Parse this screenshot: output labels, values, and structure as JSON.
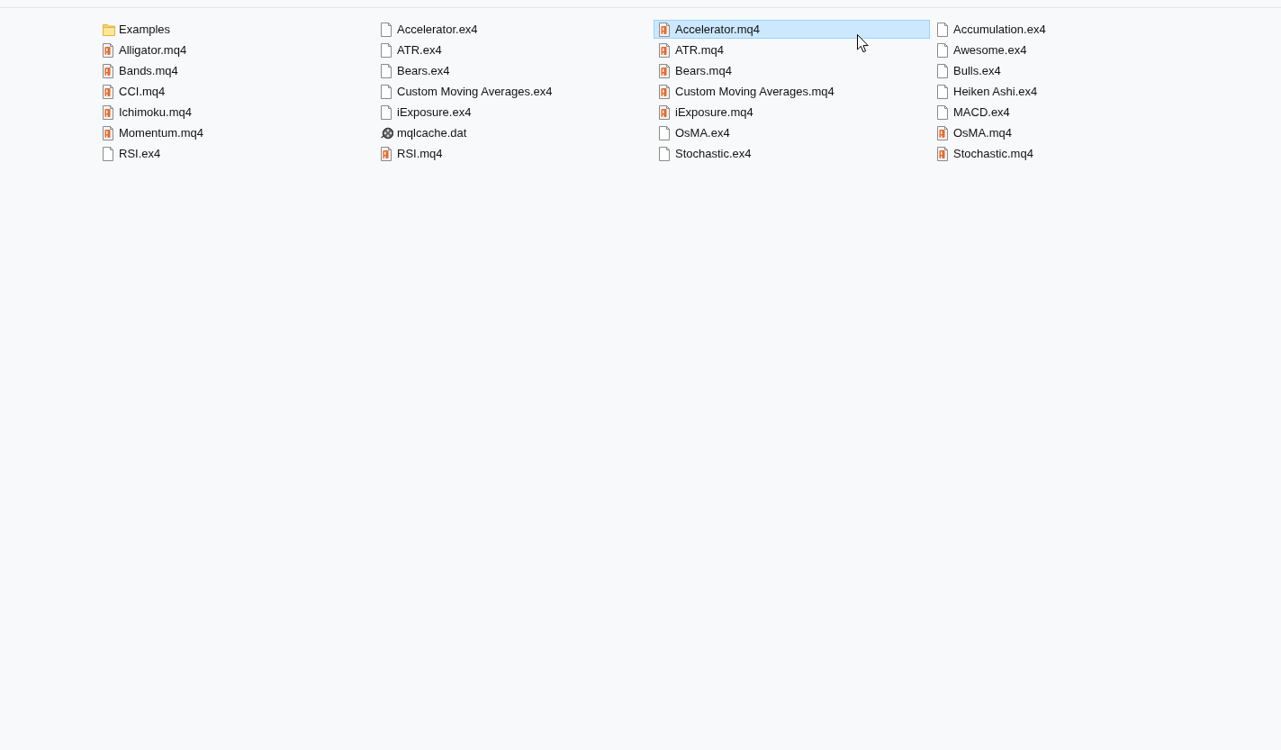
{
  "files": [
    {
      "name": "Examples",
      "kind": "folder",
      "selected": false
    },
    {
      "name": "Alligator.mq4",
      "kind": "source",
      "selected": false
    },
    {
      "name": "Bands.mq4",
      "kind": "source",
      "selected": false
    },
    {
      "name": "CCI.mq4",
      "kind": "source",
      "selected": false
    },
    {
      "name": "Ichimoku.mq4",
      "kind": "source",
      "selected": false
    },
    {
      "name": "Momentum.mq4",
      "kind": "source",
      "selected": false
    },
    {
      "name": "RSI.ex4",
      "kind": "binary",
      "selected": false
    },
    {
      "name": "Accelerator.ex4",
      "kind": "binary",
      "selected": false
    },
    {
      "name": "ATR.ex4",
      "kind": "binary",
      "selected": false
    },
    {
      "name": "Bears.ex4",
      "kind": "binary",
      "selected": false
    },
    {
      "name": "Custom Moving Averages.ex4",
      "kind": "binary",
      "selected": false
    },
    {
      "name": "iExposure.ex4",
      "kind": "binary",
      "selected": false
    },
    {
      "name": "mqlcache.dat",
      "kind": "data",
      "selected": false
    },
    {
      "name": "RSI.mq4",
      "kind": "source",
      "selected": false
    },
    {
      "name": "Accelerator.mq4",
      "kind": "source",
      "selected": true
    },
    {
      "name": "ATR.mq4",
      "kind": "source",
      "selected": false
    },
    {
      "name": "Bears.mq4",
      "kind": "source",
      "selected": false
    },
    {
      "name": "Custom Moving Averages.mq4",
      "kind": "source",
      "selected": false
    },
    {
      "name": "iExposure.mq4",
      "kind": "source",
      "selected": false
    },
    {
      "name": "OsMA.ex4",
      "kind": "binary",
      "selected": false
    },
    {
      "name": "Stochastic.ex4",
      "kind": "binary",
      "selected": false
    },
    {
      "name": "Accumulation.ex4",
      "kind": "binary",
      "selected": false
    },
    {
      "name": "Awesome.ex4",
      "kind": "binary",
      "selected": false
    },
    {
      "name": "Bulls.ex4",
      "kind": "binary",
      "selected": false
    },
    {
      "name": "Heiken Ashi.ex4",
      "kind": "binary",
      "selected": false
    },
    {
      "name": "MACD.ex4",
      "kind": "binary",
      "selected": false
    },
    {
      "name": "OsMA.mq4",
      "kind": "source",
      "selected": false
    },
    {
      "name": "Stochastic.mq4",
      "kind": "source",
      "selected": false
    }
  ]
}
